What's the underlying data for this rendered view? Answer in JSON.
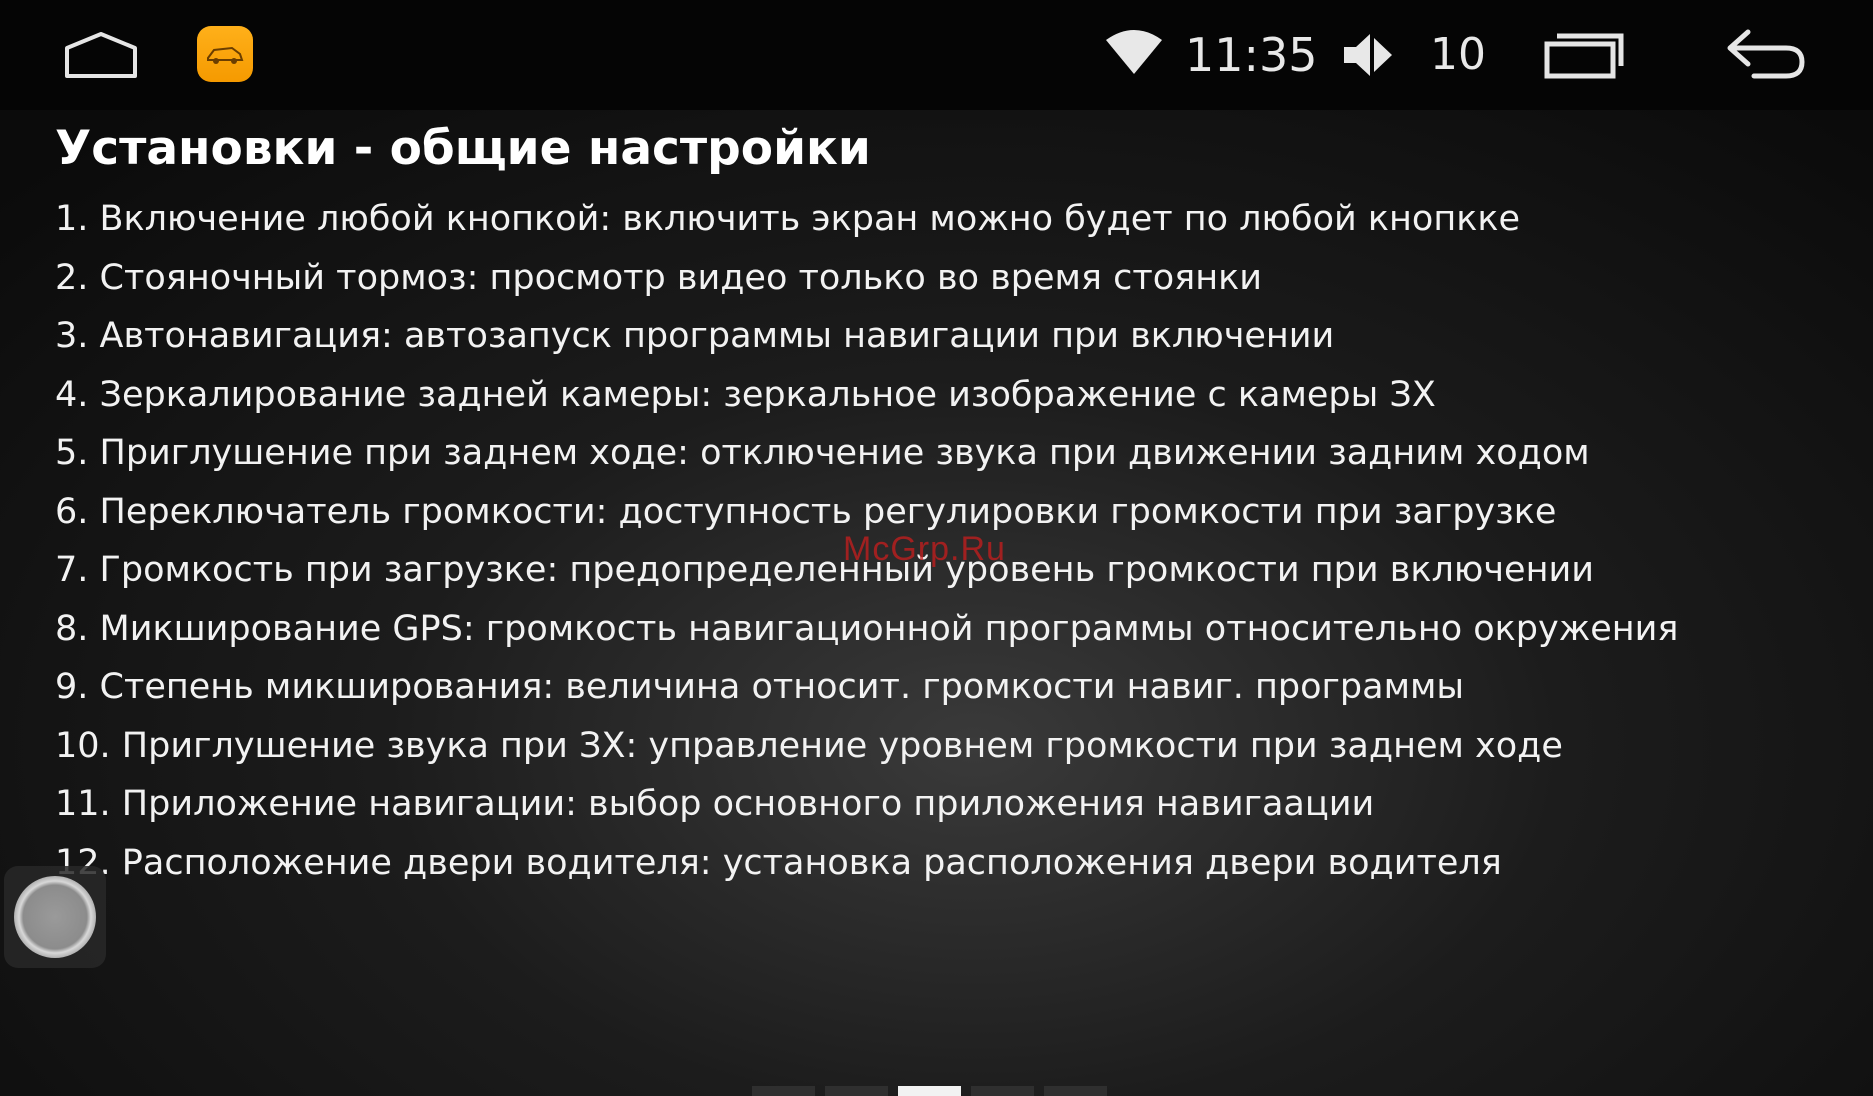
{
  "status_bar": {
    "time": "11:35",
    "volume_level": "10",
    "icons": [
      "home-icon",
      "app-icon",
      "wifi-icon",
      "volume-icon",
      "recents-icon",
      "back-icon"
    ]
  },
  "content": {
    "title": "Установки - общие настройки",
    "items": [
      "1. Включение любой кнопкой: включить экран можно будет по любой кнопкке",
      "2. Стояночный тормоз: просмотр видео только во время стоянки",
      "3. Автонавигация: автозапуск программы навигации при включении",
      "4. Зеркалирование задней камеры: зеркальное изображение с камеры ЗХ",
      "5. Приглушение при заднем ходе: отключение звука при движении задним ходом",
      "6. Переключатель громкости: доступность регулировки громкости при загрузке",
      "7. Громкость при загрузке: предопределенный уровень громкости при включении",
      "8. Микширование GPS: громкость навигационной программы относительно окружения",
      "9. Степень микширования: величина относит. громкости навиг. программы",
      "10. Приглушение звука при ЗХ: управление уровнем громкости при заднем ходе",
      "11. Приложение навигации: выбор основного приложения навигаации",
      "12. Расположение двери водителя: установка расположения двери водителя"
    ]
  },
  "watermark": "McGrp.Ru",
  "page_indicator": {
    "count": 5,
    "active_index": 2
  },
  "colors": {
    "status_bar_bg": "#050505",
    "app_icon": "#f7a10a",
    "watermark": "#c81e1e",
    "text": "#f2f2f2"
  }
}
